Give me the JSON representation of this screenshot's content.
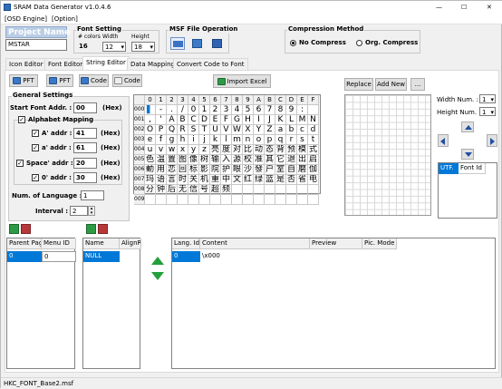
{
  "window": {
    "title": "SRAM Data Generator v1.0.4.6",
    "minimize": "—",
    "maximize": "☐",
    "close": "✕"
  },
  "menu": [
    "[OSD Engine]",
    "[Option]"
  ],
  "project": {
    "title": "Project Name",
    "value": "MSTAR"
  },
  "font_setting": {
    "title": "Font Setting",
    "colors_label": "# colors",
    "width_label": "Width",
    "height_label": "Height",
    "colors_value": "16",
    "width_value": "12",
    "height_value": "18"
  },
  "msf": {
    "title": "MSF File Operation"
  },
  "compression": {
    "title": "Compression Method",
    "options": [
      "No Compress",
      "Org. Compress"
    ],
    "selected": "No Compress"
  },
  "tabs": [
    "Icon Editor",
    "Font Editor",
    "String Editor",
    "Data Mapping",
    "Convert Code to Font"
  ],
  "active_tab": "String Editor",
  "toolbar": {
    "pft1": "PFT",
    "pft2": "PFT",
    "code1": "Code",
    "code2": "Code",
    "import_excel": "Import Excel"
  },
  "general": {
    "title": "General Settings",
    "start_font_label": "Start Font Addr. :",
    "start_font_value": "00",
    "hex": "(Hex)",
    "alphabet_mapping": "Alphabet Mapping",
    "A_addr_label": "A' addr :",
    "A_addr_value": "41",
    "a_addr_label": "a' addr :",
    "a_addr_value": "61",
    "space_label": "Space' addr :",
    "space_value": "20",
    "zero_label": "0' addr :",
    "zero_value": "30",
    "num_lang_label": "Num. of Language :",
    "num_lang_value": "1",
    "interval_label": "Interval :",
    "interval_value": "2"
  },
  "grid": {
    "col_headers": [
      "0",
      "1",
      "2",
      "3",
      "4",
      "5",
      "6",
      "7",
      "8",
      "9",
      "A",
      "B",
      "C",
      "D",
      "E",
      "F"
    ],
    "row_headers": [
      "000",
      "001",
      "002",
      "003",
      "004",
      "005",
      "006",
      "007",
      "008",
      "009"
    ],
    "rows": [
      [
        "▌",
        "-",
        ".",
        "/",
        "0",
        "1",
        "2",
        "3",
        "4",
        "5",
        "6",
        "7",
        "8",
        "9",
        ":",
        ""
      ],
      [
        ",",
        "'",
        "A",
        "B",
        "C",
        "D",
        "E",
        "F",
        "G",
        "H",
        "I",
        "J",
        "K",
        "L",
        "M",
        "N"
      ],
      [
        "O",
        "P",
        "Q",
        "R",
        "S",
        "T",
        "U",
        "V",
        "W",
        "X",
        "Y",
        "Z",
        "a",
        "b",
        "c",
        "d"
      ],
      [
        "e",
        "f",
        "g",
        "h",
        "i",
        "j",
        "k",
        "l",
        "m",
        "n",
        "o",
        "p",
        "q",
        "r",
        "s",
        "t"
      ],
      [
        "u",
        "v",
        "w",
        "x",
        "y",
        "z",
        "亮",
        "度",
        "对",
        "比",
        "动",
        "态",
        "背",
        "预",
        "模",
        "式"
      ],
      [
        "色",
        "温",
        "置",
        "图",
        "像",
        "树",
        "输",
        "入",
        "源",
        "校",
        "准",
        "其",
        "它",
        "退",
        "出",
        "启"
      ],
      [
        "動",
        "用",
        "恋",
        "回",
        "标",
        "影",
        "院",
        "护",
        "眼",
        "沙",
        "發",
        "户",
        "室",
        "自",
        "磨",
        "伽"
      ],
      [
        "玛",
        "语",
        "言",
        "时",
        "关",
        "机",
        "重",
        "中",
        "文",
        "红",
        "绿",
        "蓝",
        "是",
        "否",
        "省",
        "电"
      ],
      [
        "分",
        "钟",
        "后",
        "无",
        "信",
        "号",
        "超",
        "频",
        "",
        "",
        "",
        "",
        "",
        "",
        "",
        ""
      ],
      [
        "",
        "",
        "",
        "",
        "",
        "",
        "",
        "",
        "",
        "",
        "",
        "",
        "",
        "",
        "",
        ""
      ]
    ]
  },
  "right_panel": {
    "replace": "Replace",
    "add_new": "Add New",
    "more": "...",
    "width_num_label": "Width Num. :",
    "width_num_value": "1",
    "height_num_label": "Height Num. :",
    "height_num_value": "1",
    "utf_label": "UTF.",
    "font_id_label": "Font Id"
  },
  "parent_table": {
    "headers": [
      "Parent Pag",
      "Menu ID"
    ],
    "rows": [
      [
        "0",
        "0"
      ]
    ]
  },
  "name_table": {
    "headers": [
      "Name",
      "AlignR"
    ],
    "rows": [
      [
        "NULL",
        ""
      ]
    ]
  },
  "lang_table": {
    "headers": [
      "Lang. Id",
      "Content",
      "Preview",
      "Pic. Mode"
    ],
    "rows": [
      [
        "0",
        "\\x000",
        "",
        ""
      ]
    ]
  },
  "status": {
    "file": "HKC_FONT_Base2.msf"
  }
}
